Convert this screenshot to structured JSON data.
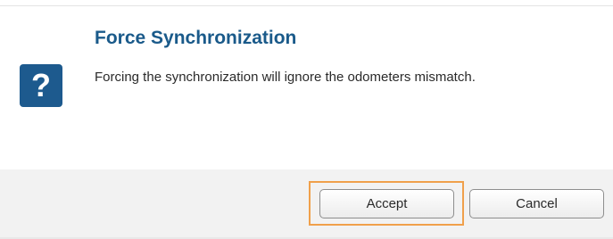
{
  "dialog": {
    "title": "Force Synchronization",
    "icon": "question-icon",
    "icon_glyph": "?",
    "message": "Forcing the synchronization will ignore the odometers mismatch.",
    "buttons": {
      "accept_label": "Accept",
      "cancel_label": "Cancel"
    },
    "colors": {
      "title": "#1a5a8a",
      "icon_bg": "#1d5a8e",
      "focus_ring": "#f0a04b"
    }
  }
}
